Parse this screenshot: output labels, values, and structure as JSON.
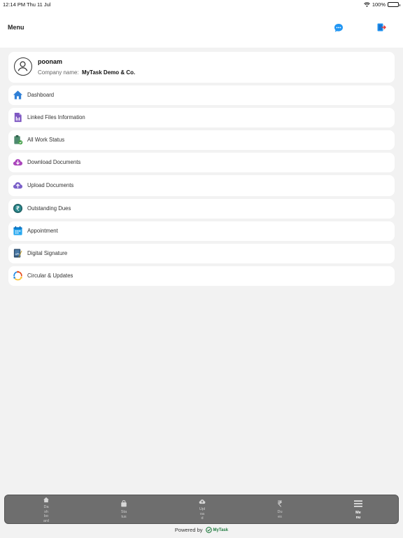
{
  "status_bar": {
    "time": "12:14 PM",
    "date": "Thu 11 Jul",
    "battery": "100%"
  },
  "header": {
    "title": "Menu"
  },
  "profile": {
    "name": "poonam",
    "company_label": "Company name:",
    "company_value": "MyTask Demo & Co."
  },
  "menu": {
    "items": [
      {
        "label": "Dashboard",
        "icon": "home-icon"
      },
      {
        "label": "Linked Files Information",
        "icon": "document-icon"
      },
      {
        "label": "All Work Status",
        "icon": "clipboard-check-icon"
      },
      {
        "label": "Download Documents",
        "icon": "cloud-download-icon"
      },
      {
        "label": " Upload Documents",
        "icon": "cloud-upload-icon"
      },
      {
        "label": "Outstanding Dues",
        "icon": "rupee-coin-icon"
      },
      {
        "label": "Appointment",
        "icon": "calendar-icon"
      },
      {
        "label": "Digital Signature",
        "icon": "signature-icon"
      },
      {
        "label": "Circular & Updates",
        "icon": "sync-circle-icon"
      }
    ]
  },
  "bottom_nav": {
    "items": [
      {
        "label": "Da\nsh\nbo\nard",
        "icon": "home-icon",
        "active": false
      },
      {
        "label": "Sta\ntus",
        "icon": "bag-icon",
        "active": false
      },
      {
        "label": "Upl\noa\nd",
        "icon": "cloud-upload-icon",
        "active": false
      },
      {
        "label": "Du\nes",
        "icon": "rupee-icon",
        "active": false
      },
      {
        "label": "Me\nnu",
        "icon": "hamburger-icon",
        "active": true
      }
    ]
  },
  "footer": {
    "powered_by": "Powered by",
    "brand": "MyTask"
  },
  "colors": {
    "accent": "#2196f3",
    "nav_background": "#6e6e6e",
    "page_background": "#f2f2f2"
  }
}
